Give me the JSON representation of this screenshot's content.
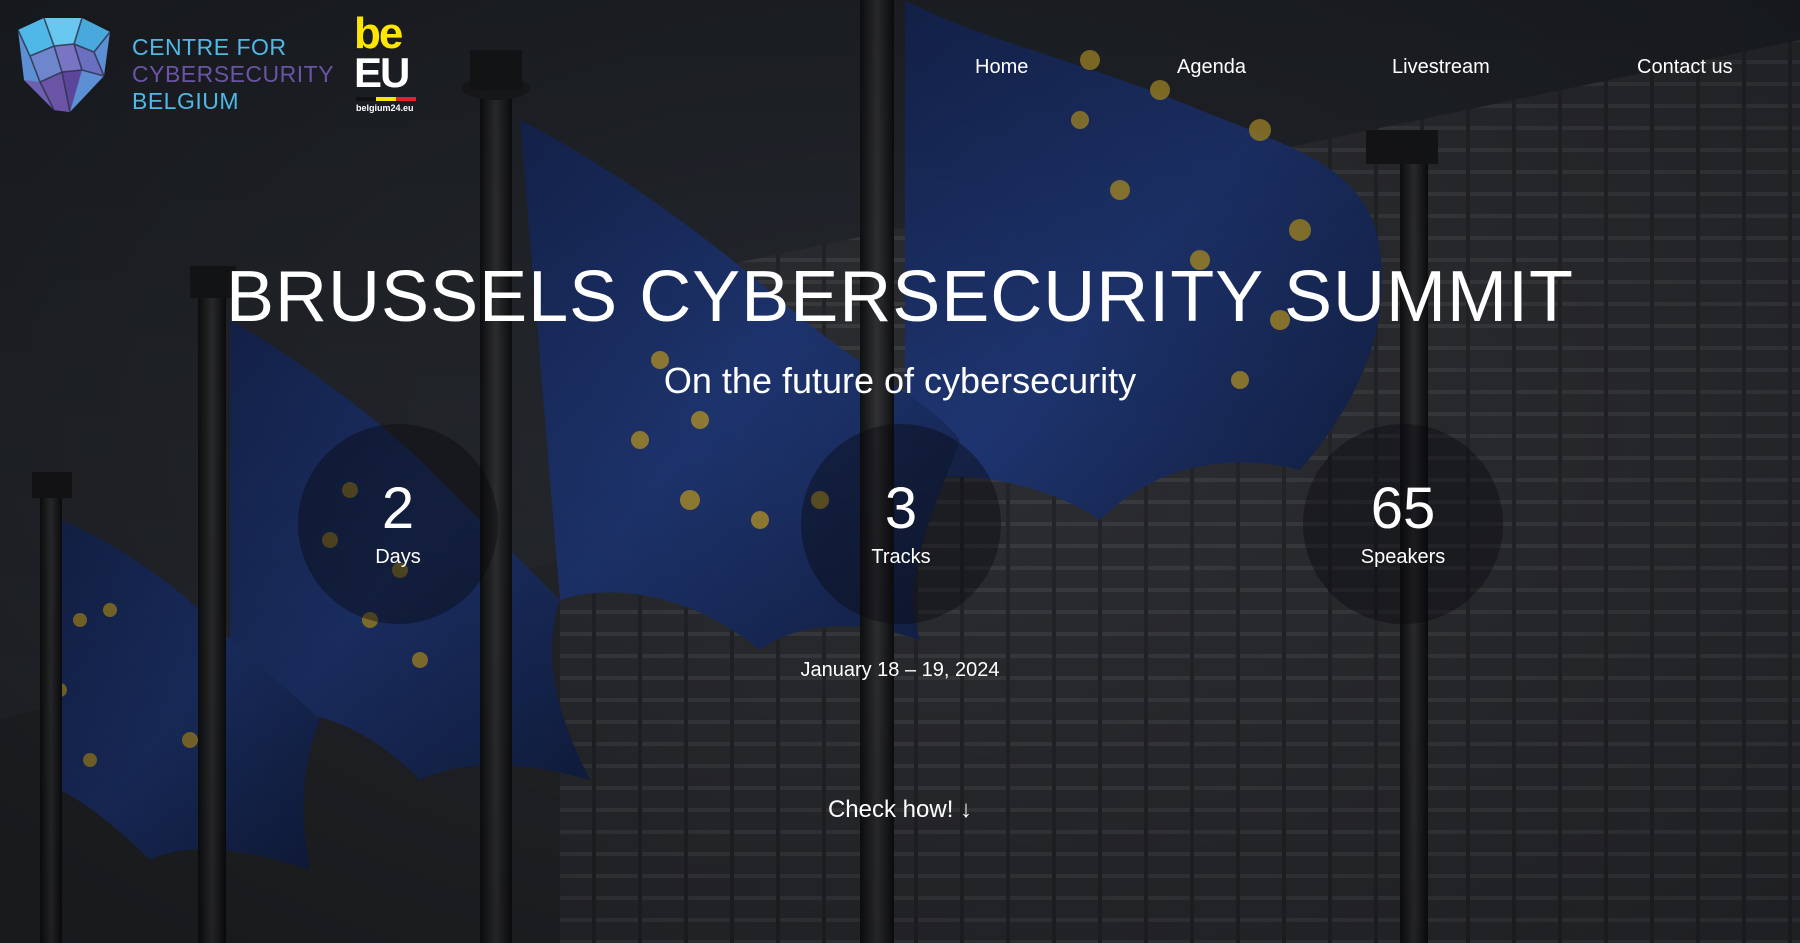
{
  "header": {
    "logo_ccb": {
      "line1": "CENTRE FOR",
      "line2": "CYBERSECURITY",
      "line3": "BELGIUM",
      "colors": {
        "light_blue": "#4fb8e6",
        "purple": "#6b54a6"
      }
    },
    "logo_beeu": {
      "top": "be",
      "bottom": "EU",
      "url": "belgium24.eu",
      "colors": {
        "yellow": "#ffe600",
        "black": "#111111",
        "red": "#e3232c"
      }
    },
    "nav": [
      {
        "label": "Home"
      },
      {
        "label": "Agenda"
      },
      {
        "label": "Livestream"
      },
      {
        "label": "Contact us"
      }
    ]
  },
  "hero": {
    "title": "BRUSSELS CYBERSECURITY SUMMIT",
    "subtitle": "On the future of cybersecurity",
    "stats": [
      {
        "value": "2",
        "label": "Days"
      },
      {
        "value": "3",
        "label": "Tracks"
      },
      {
        "value": "65",
        "label": "Speakers"
      }
    ],
    "date": "January 18 – 19, 2024",
    "cta": "Check how! ↓"
  },
  "background": {
    "image_icon": "eu-flags-photo",
    "colors": {
      "flag_blue": "#1f3a7a",
      "star_gold": "#c9a733",
      "building": "#2f3136"
    }
  }
}
